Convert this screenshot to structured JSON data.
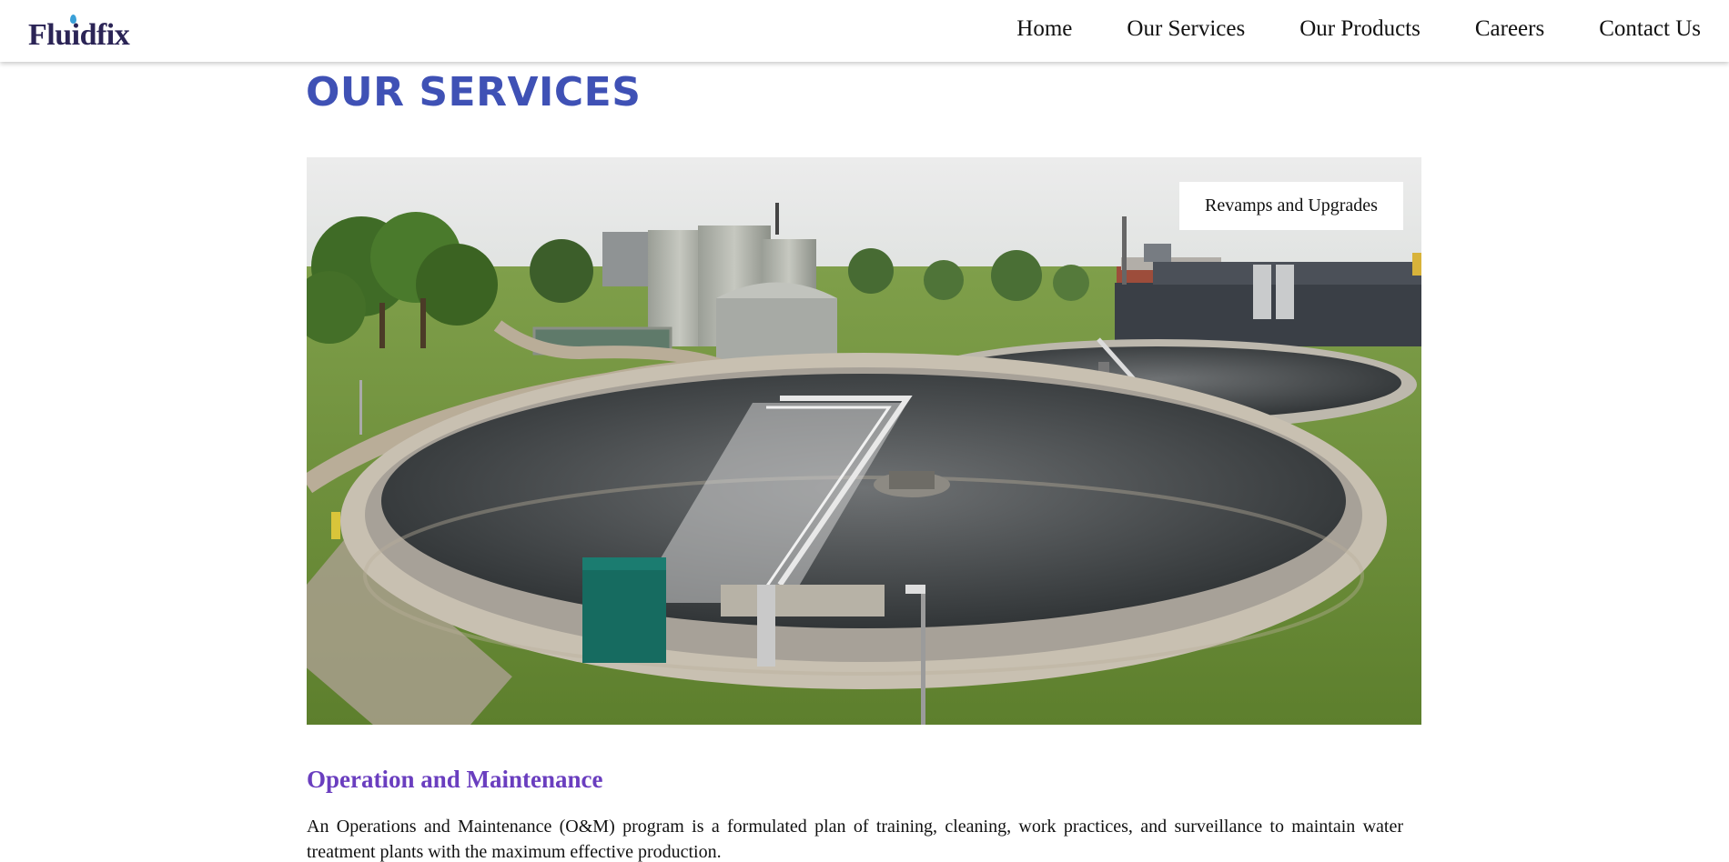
{
  "header": {
    "logo_text": "Fluidfix",
    "nav": [
      {
        "label": "Home"
      },
      {
        "label": "Our Services"
      },
      {
        "label": "Our Products"
      },
      {
        "label": "Careers"
      },
      {
        "label": "Contact Us"
      }
    ]
  },
  "main": {
    "page_title": "OUR SERVICES",
    "hero": {
      "badge_label": "Revamps and Upgrades"
    },
    "section": {
      "heading": "Operation and Maintenance",
      "body": "An Operations and Maintenance (O&M) program is a formulated plan of training, cleaning, work practices, and surveillance to maintain water treatment plants with the maximum effective production."
    }
  },
  "colors": {
    "title": "#3f51b5",
    "section_heading": "#6a3ebf",
    "logo": "#2b2456",
    "logo_drop": "#3aa0d8"
  }
}
